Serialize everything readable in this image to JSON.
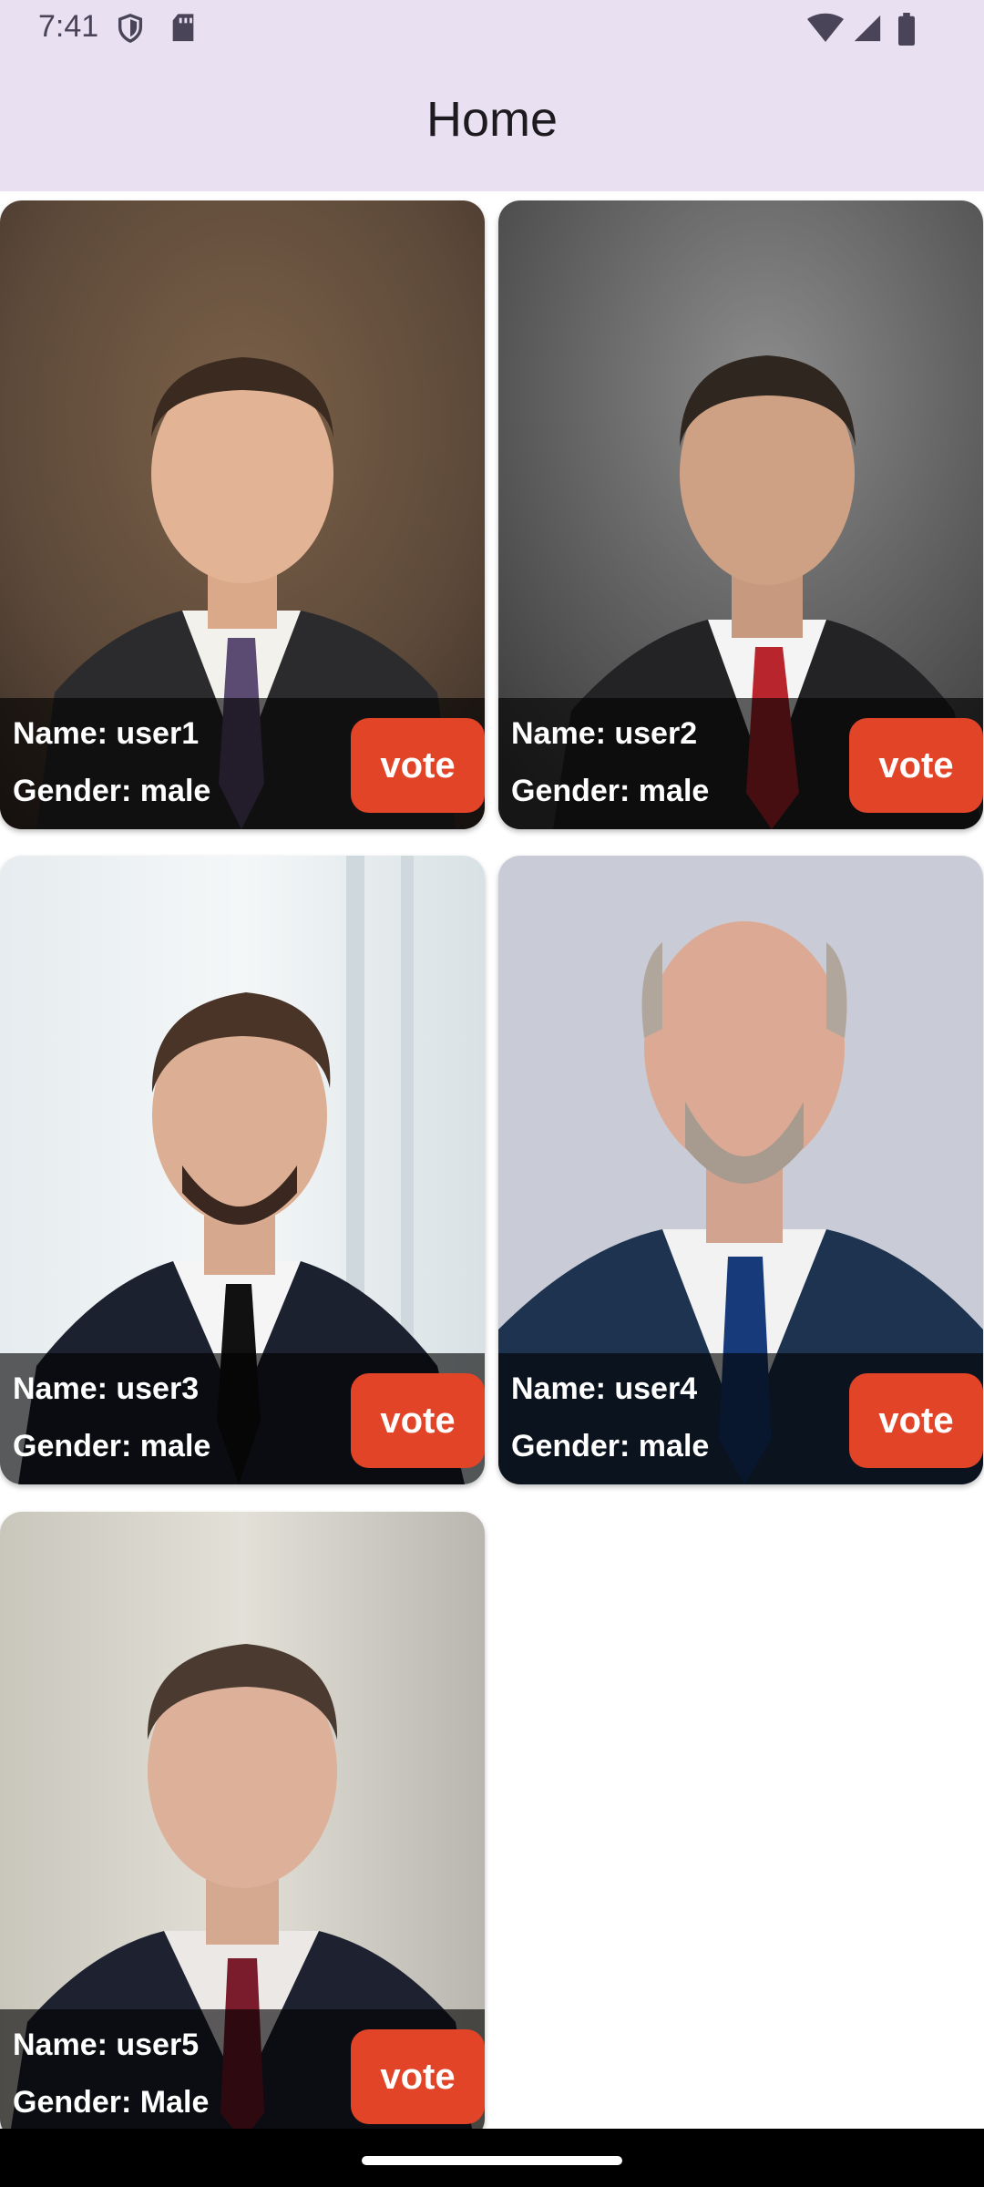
{
  "status_bar": {
    "time": "7:41",
    "icons": [
      "shield-icon",
      "sd-card-icon",
      "wifi-icon",
      "signal-icon",
      "battery-icon"
    ]
  },
  "app_bar": {
    "title": "Home"
  },
  "cards": [
    {
      "name": "Name: user1",
      "gender": "Gender: male",
      "vote_label": "vote"
    },
    {
      "name": "Name: user2",
      "gender": "Gender: male",
      "vote_label": "vote"
    },
    {
      "name": "Name: user3",
      "gender": "Gender: male",
      "vote_label": "vote"
    },
    {
      "name": "Name: user4",
      "gender": "Gender: male",
      "vote_label": "vote"
    },
    {
      "name": "Name: user5",
      "gender": "Gender: Male",
      "vote_label": "vote"
    }
  ],
  "colors": {
    "app_bar_bg": "#e9e1f1",
    "vote_button": "#e24427",
    "overlay": "#000000"
  }
}
